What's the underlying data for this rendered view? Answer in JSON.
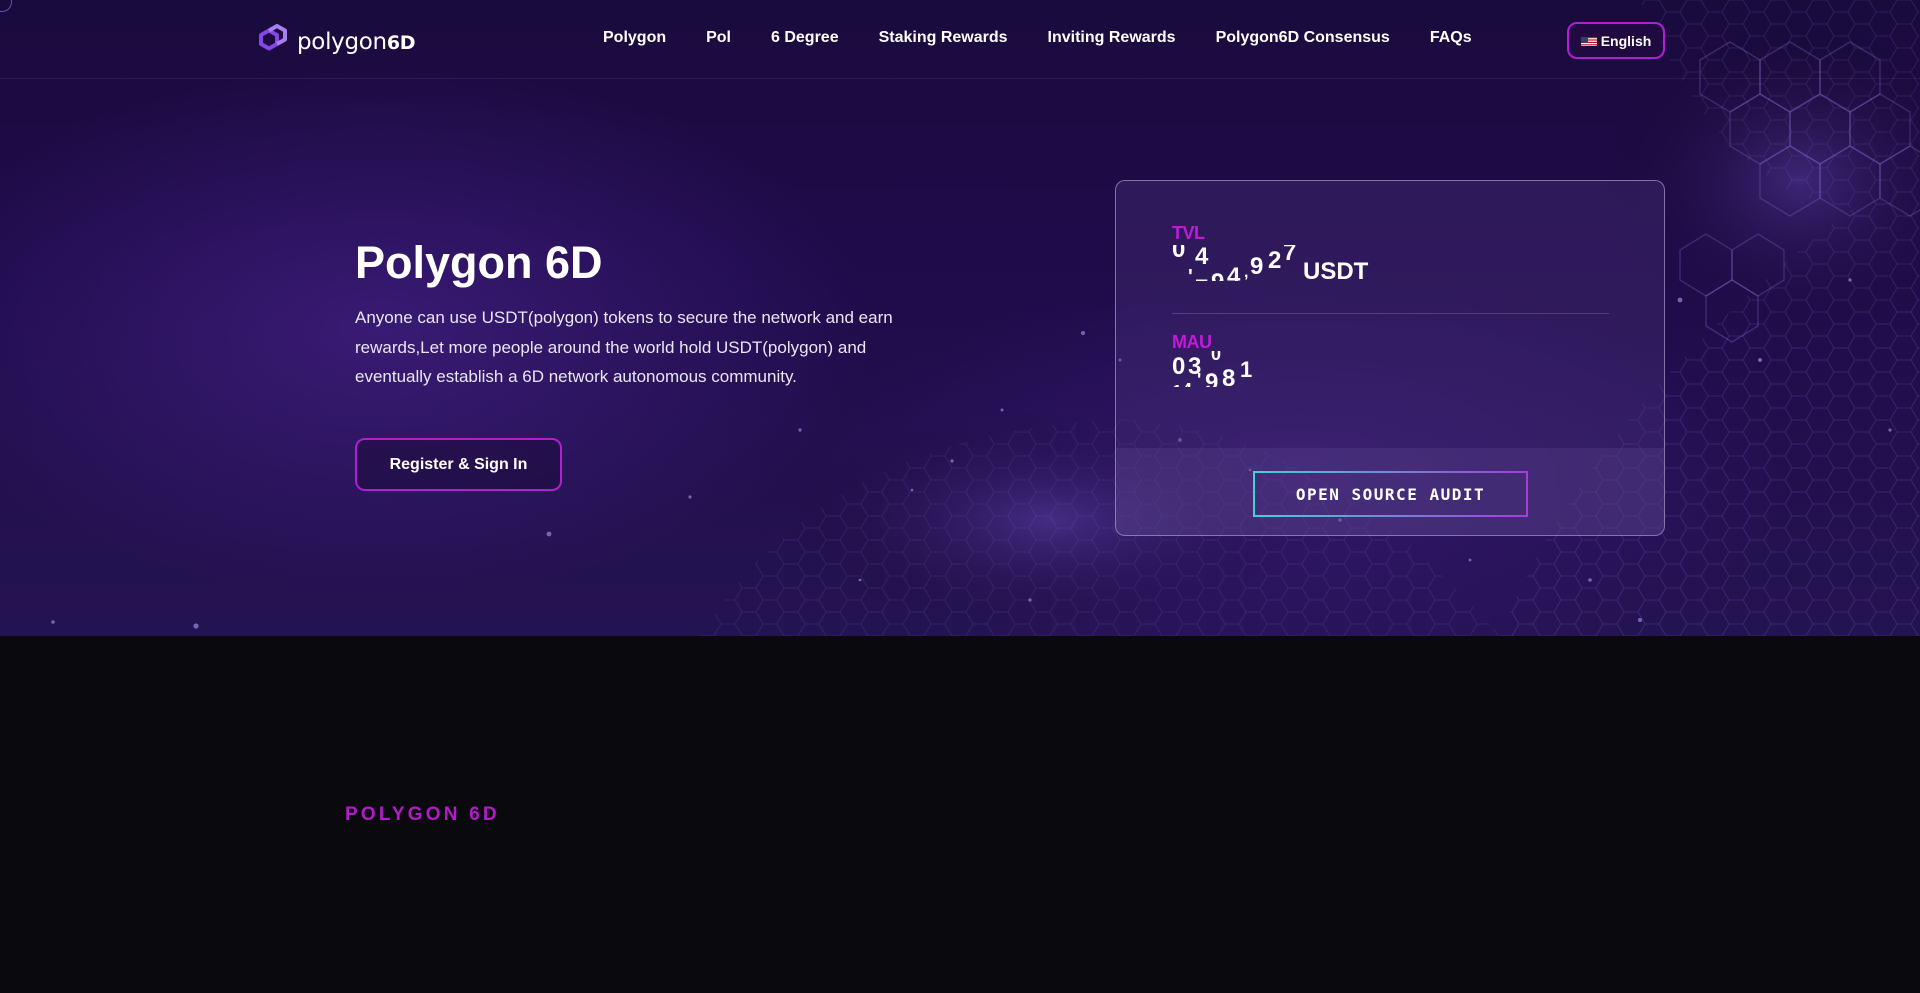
{
  "nav": {
    "logo_text": "polygon",
    "logo_sup": "6D",
    "links": [
      "Polygon",
      "Pol",
      "6 Degree",
      "Staking Rewards",
      "Inviting Rewards",
      "Polygon6D Consensus",
      "FAQs"
    ],
    "language": "English"
  },
  "hero": {
    "title": "Polygon 6D",
    "description": "Anyone can use USDT(polygon) tokens to secure the network and earn rewards,Let more people around the world hold USDT(polygon) and eventually establish a 6D network autonomous community.",
    "cta_label": "Register & Sign In"
  },
  "stats": {
    "tvl_label": "TVL",
    "tvl_unit": "USDT",
    "mau_label": "MAU",
    "audit_label": "OPEN SOURCE AUDIT"
  },
  "section": {
    "eyebrow": "POLYGON 6D"
  },
  "colors": {
    "accent_magenta": "#b01fd2",
    "label_magenta": "#c21ad9",
    "audit_gradient_start": "#3fd3d3",
    "audit_gradient_end": "#a63bd8",
    "hero_bg": "#1f0b4a",
    "page_bg": "#0a0a0e"
  },
  "icons": {
    "logo": "polygon-logo-icon",
    "flag": "us-flag-icon"
  }
}
